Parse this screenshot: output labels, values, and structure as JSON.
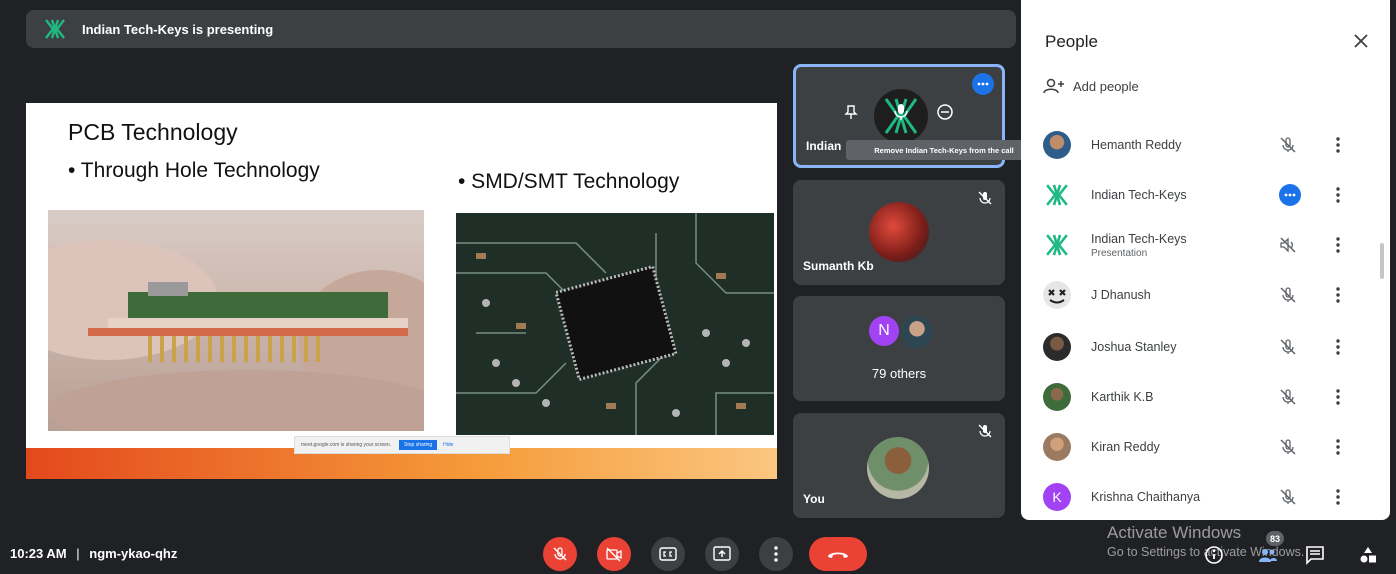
{
  "banner": {
    "text": "Indian Tech-Keys is presenting"
  },
  "slide": {
    "title": "PCB Technology",
    "bullet_left": "• Through Hole Technology",
    "bullet_right": "• SMD/SMT Technology",
    "share_text": "meet.google.com is sharing your screen.",
    "share_stop": "Stop sharing",
    "share_hide": "Hide"
  },
  "tiles": {
    "indian": {
      "name": "Indian",
      "tooltip": "Remove Indian Tech-Keys from the call"
    },
    "sumanth": {
      "name": "Sumanth Kb"
    },
    "others": {
      "label": "79 others",
      "initial": "N"
    },
    "you": {
      "name": "You"
    }
  },
  "people": {
    "title": "People",
    "add_label": "Add people",
    "list": [
      {
        "name": "Hemanth Reddy",
        "sub": ""
      },
      {
        "name": "Indian Tech-Keys",
        "sub": ""
      },
      {
        "name": "Indian Tech-Keys",
        "sub": "Presentation"
      },
      {
        "name": "J Dhanush",
        "sub": ""
      },
      {
        "name": "Joshua Stanley",
        "sub": ""
      },
      {
        "name": "Karthik K.B",
        "sub": ""
      },
      {
        "name": "Kiran Reddy",
        "sub": ""
      },
      {
        "name": "Krishna Chaithanya",
        "sub": "",
        "initial": "K"
      }
    ]
  },
  "bottom": {
    "time": "10:23 AM",
    "separator": "|",
    "meeting_code": "ngm-ykao-qhz",
    "participants_count": "83"
  },
  "watermark": {
    "line1": "Activate Windows",
    "line2": "Go to Settings to activate Windows."
  },
  "colors": {
    "accent": "#1a73e8",
    "red": "#ea4335",
    "logo_green": "#1fb981"
  }
}
